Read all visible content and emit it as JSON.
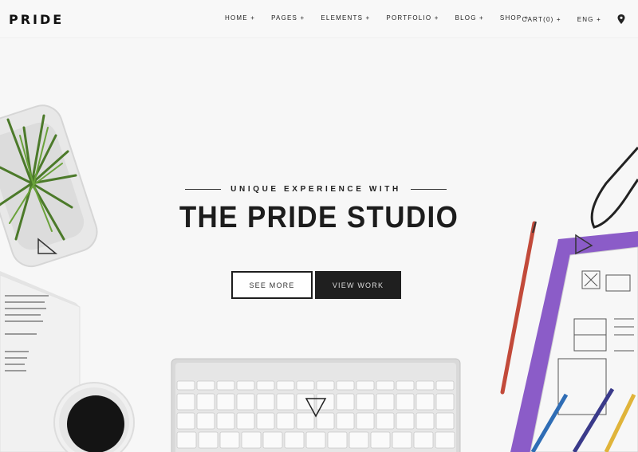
{
  "brand": {
    "logo": "PRIDE"
  },
  "nav": {
    "items": [
      {
        "label": "HOME +"
      },
      {
        "label": "PAGES +"
      },
      {
        "label": "ELEMENTS +"
      },
      {
        "label": "PORTFOLIO +"
      },
      {
        "label": "BLOG +"
      },
      {
        "label": "SHOP +"
      }
    ],
    "cart": "CART(0) +",
    "lang": "ENG +",
    "location_icon": "map-pin-icon"
  },
  "hero": {
    "subtitle": "UNIQUE EXPERIENCE WITH",
    "title": "THE PRIDE STUDIO",
    "btn_primary": "SEE MORE",
    "btn_secondary": "VIEW WORK"
  },
  "colors": {
    "accent_dark": "#1f1f1f",
    "purple_folder": "#8b5cc8",
    "background": "#f7f7f7"
  }
}
